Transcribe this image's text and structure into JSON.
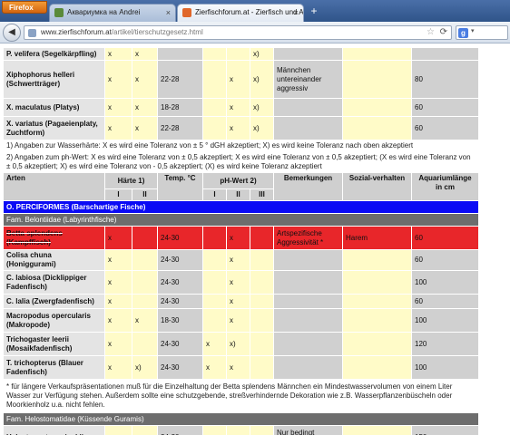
{
  "browser": {
    "menu_label": "Firefox",
    "tabs": [
      {
        "title": "Аквариумка на Andrei",
        "active": false
      },
      {
        "title": "Zierfischforum.at - Zierfisch und Aqu...",
        "active": true
      }
    ],
    "new_tab_label": "+",
    "url_domain": "www.zierfischforum.at",
    "url_path": "/artikel/tierschutzgesetz.html",
    "search_engine": "Google"
  },
  "table": {
    "top_rows": [
      {
        "name": "P. velifera (Segelkärpfling)",
        "h1": "x",
        "h2": "x",
        "temp": "",
        "p1": "",
        "p2": "",
        "p3": "x)",
        "bem": "",
        "soz": "",
        "aq": ""
      },
      {
        "name": "Xiphophorus helleri (Schwertträger)",
        "h1": "x",
        "h2": "x",
        "temp": "22-28",
        "p1": "",
        "p2": "x",
        "p3": "x)",
        "bem": "Männchen untereinander aggressiv",
        "soz": "",
        "aq": "80"
      },
      {
        "name": "X. maculatus (Platys)",
        "h1": "x",
        "h2": "x",
        "temp": "18-28",
        "p1": "",
        "p2": "x",
        "p3": "x)",
        "bem": "",
        "soz": "",
        "aq": "60"
      },
      {
        "name": "X. variatus (Pagaeienplaty, Zuchtform)",
        "h1": "x",
        "h2": "x",
        "temp": "22-28",
        "p1": "",
        "p2": "x",
        "p3": "x)",
        "bem": "",
        "soz": "",
        "aq": "60"
      }
    ],
    "note1": "1) Angaben zur Wasserhärte: X es wird eine Toleranz von ± 5 ° dGH akzeptiert; X) es wird keine Toleranz nach oben akzeptiert",
    "note2": "2) Angaben zum ph-Wert: X es wird eine Toleranz von ± 0,5 akzeptiert; X es wird eine Toleranz von ± 0,5 akzeptiert; (X es wird eine Toleranz von ± 0,5 akzeptiert; X) es wird eine Toleranz von - 0,5 akzeptiert; (X) es wird keine Toleranz akzeptiert",
    "headers": {
      "arten": "Arten",
      "haerte": "Härte 1)",
      "temp": "Temp. °C",
      "ph": "pH-Wert 2)",
      "bem": "Bemerkungen",
      "soz": "Sozial-verhalten",
      "aq": "Aquariumlänge in cm",
      "i": "I",
      "ii": "II",
      "iii": "III"
    },
    "order_label": "O. PERCIFORMES (Barschartige Fische)",
    "family1_label": "Fam. Belontiidae (Labyrinthfische)",
    "rows": [
      {
        "name": "Betta splendens (Kampffisch)",
        "h1": "x",
        "h2": "",
        "temp": "24-30",
        "p1": "",
        "p2": "x",
        "p3": "",
        "bem": "Artspezifische Aggressivität *",
        "soz": "Harem",
        "aq": "60",
        "highlight": true
      },
      {
        "name": "Colisa chuna (Honiggurami)",
        "h1": "x",
        "h2": "",
        "temp": "24-30",
        "p1": "",
        "p2": "x",
        "p3": "",
        "bem": "",
        "soz": "",
        "aq": "60",
        "highlight": false
      },
      {
        "name": "C. labiosa (Dicklippiger Fadenfisch)",
        "h1": "x",
        "h2": "",
        "temp": "24-30",
        "p1": "",
        "p2": "x",
        "p3": "",
        "bem": "",
        "soz": "",
        "aq": "100",
        "highlight": false
      },
      {
        "name": "C. lalia (Zwergfadenfisch)",
        "h1": "x",
        "h2": "",
        "temp": "24-30",
        "p1": "",
        "p2": "x",
        "p3": "",
        "bem": "",
        "soz": "",
        "aq": "60",
        "highlight": false
      },
      {
        "name": "Macropodus opercularis (Makropode)",
        "h1": "x",
        "h2": "x",
        "temp": "18-30",
        "p1": "",
        "p2": "x",
        "p3": "",
        "bem": "",
        "soz": "",
        "aq": "100",
        "highlight": false
      },
      {
        "name": "Trichogaster leerii (Mosaikfadenfisch)",
        "h1": "x",
        "h2": "",
        "temp": "24-30",
        "p1": "x",
        "p2": "x)",
        "p3": "",
        "bem": "",
        "soz": "",
        "aq": "120",
        "highlight": false
      },
      {
        "name": "T. trichopterus (Blauer Fadenfisch)",
        "h1": "x",
        "h2": "x)",
        "temp": "24-30",
        "p1": "x",
        "p2": "x",
        "p3": "",
        "bem": "",
        "soz": "",
        "aq": "100",
        "highlight": false
      }
    ],
    "footnote": "* für längere Verkaufspräsentationen muß für die Einzelhaltung der Betta splendens Männchen ein Mindestwasservolumen von einem Liter Wasser zur Verfügung stehen. Außerdem sollte eine schutzgebende, streßverhindernde Dekoration wie z.B. Wasserpflanzenbüscheln oder Moorkienholz u.a. nicht fehlen.",
    "family2_label": "Fam. Helostomatidae (Küssende Guramis)",
    "last_row": {
      "name": "Helostoma temminckii",
      "h1": "x",
      "h2": "",
      "temp": "24-30",
      "p1": "",
      "p2": "x",
      "p3": "",
      "bem": "Nur bedingt geeignet als",
      "soz": "",
      "aq": "150"
    }
  },
  "colors": {
    "order_blue": "#0a0af5",
    "highlight_red": "#e8262a",
    "family_gray": "#6d6d6d"
  }
}
